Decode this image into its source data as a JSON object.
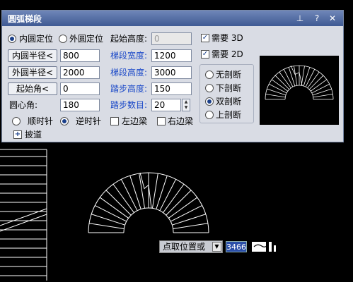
{
  "dialog": {
    "title": "圆弧梯段",
    "pin_icon": "pin-icon",
    "help_label": "?",
    "close_label": "✕"
  },
  "form": {
    "inner_locate": "内圆定位",
    "outer_locate": "外圆定位",
    "inner_radius_btn": "内圆半径<",
    "inner_radius_val": "800",
    "outer_radius_btn": "外圆半径<",
    "outer_radius_val": "2000",
    "start_angle_btn": "起始角<",
    "start_angle_val": "0",
    "center_angle_label": "圆心角:",
    "center_angle_val": "180",
    "clockwise": "顺时针",
    "counterclockwise": "逆时针",
    "ramp": "披道",
    "start_height_label": "起始高度:",
    "start_height_val": "0",
    "flight_width_label": "梯段宽度:",
    "flight_width_val": "1200",
    "flight_height_label": "梯段高度:",
    "flight_height_val": "3000",
    "step_height_label": "踏步高度:",
    "step_height_val": "150",
    "step_count_label": "踏步数目:",
    "step_count_val": "20",
    "left_beam": "左边梁",
    "right_beam": "右边梁",
    "need_3d": "需要 3D",
    "need_2d": "需要 2D",
    "no_cut": "无剖断",
    "lower_cut": "下剖断",
    "double_cut": "双剖断",
    "upper_cut": "上剖断"
  },
  "command": {
    "prompt": "点取位置或",
    "coord_value": "3466"
  },
  "colors": {
    "title_bar": "#4a64a0",
    "blue_label": "#1b49c8",
    "drawing_line": "#ffffff"
  }
}
